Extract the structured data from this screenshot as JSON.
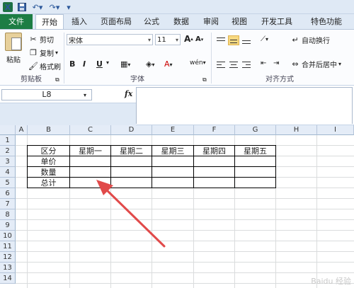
{
  "quick_access": {
    "app_icon": "X",
    "save_icon": "save-icon",
    "undo_icon": "undo-icon",
    "redo_icon": "redo-icon"
  },
  "tabs": [
    "文件",
    "开始",
    "插入",
    "页面布局",
    "公式",
    "数据",
    "审阅",
    "视图",
    "开发工具",
    "特色功能"
  ],
  "ribbon": {
    "clipboard": {
      "paste": "粘贴",
      "cut": "剪切",
      "copy": "复制",
      "copy_dd": "▾",
      "format_painter": "格式刷",
      "label": "剪贴板"
    },
    "font": {
      "name": "宋体",
      "size": "11",
      "bold": "B",
      "italic": "I",
      "underline": "U",
      "label": "字体",
      "font_color": "#c00000"
    },
    "alignment": {
      "wrap_text": "自动换行",
      "merge_center": "合并后居中",
      "label": "对齐方式"
    }
  },
  "formula_bar": {
    "name_box": "L8",
    "fx": "fx",
    "formula": ""
  },
  "grid": {
    "columns": [
      "A",
      "B",
      "C",
      "D",
      "E",
      "F",
      "G",
      "H",
      "I"
    ],
    "rows": [
      "1",
      "2",
      "3",
      "4",
      "5",
      "6",
      "7",
      "8",
      "9",
      "10",
      "11",
      "12",
      "13",
      "14"
    ],
    "table": {
      "header": [
        "区分",
        "星期一",
        "星期二",
        "星期三",
        "星期四",
        "星期五"
      ],
      "row_labels": [
        "单价",
        "数量",
        "总计"
      ]
    }
  },
  "watermark": "Baidu 经验"
}
